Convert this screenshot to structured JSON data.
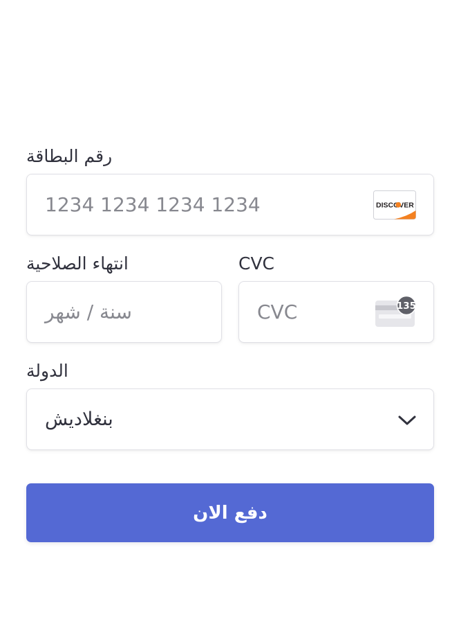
{
  "card_number": {
    "label": "رقم البطاقة",
    "placeholder": "1234 1234 1234 1234",
    "brand_icon": "discover-card-icon",
    "brand_text": "DISCOVER"
  },
  "expiry": {
    "label": "انتهاء الصلاحية",
    "placeholder": "سنة / شهر"
  },
  "cvc": {
    "label": "CVC",
    "placeholder": "CVC",
    "icon": "cvc-card-icon",
    "icon_badge": "135"
  },
  "country": {
    "label": "الدولة",
    "value": "بنغلاديش",
    "icon": "chevron-down-icon"
  },
  "submit": {
    "label": "دفع الان"
  },
  "colors": {
    "accent": "#5469d4",
    "text": "#30313d",
    "placeholder": "#87888f",
    "border": "#e0e0e6",
    "discover_orange": "#f48120"
  }
}
